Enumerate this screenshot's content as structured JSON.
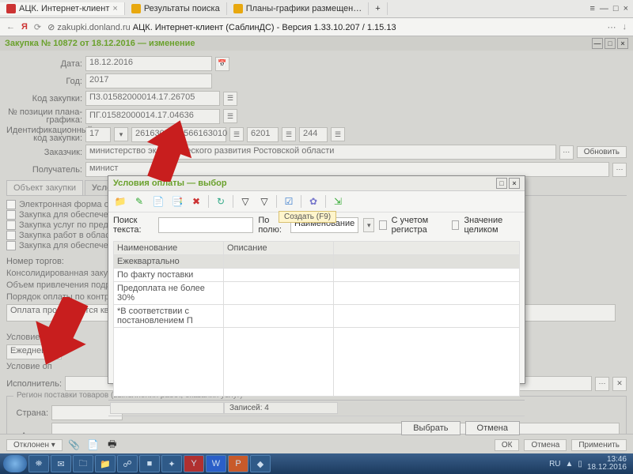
{
  "browser": {
    "tabs": [
      {
        "label": "АЦК. Интернет-клиент"
      },
      {
        "label": "Результаты поиска"
      },
      {
        "label": "Планы-графики размещен…"
      }
    ],
    "url_prefix": "zakupki.donland.ru",
    "url_rest": "  АЦК. Интернет-клиент (СаблинДС) - Версия 1.33.10.207 / 1.15.13"
  },
  "page_title": "Закупка № 10872 от 18.12.2016 — изменение",
  "form": {
    "date_lbl": "Дата:",
    "date": "18.12.2016",
    "year_lbl": "Год:",
    "year": "2017",
    "code_lbl": "Код закупки:",
    "code": "П3.01582000014.17.26705",
    "pos_lbl": "№ позиции плана-графика:",
    "pos": "ПГ.01582000014.17.04636",
    "id_lbl": "Идентификационный код закупки:",
    "id_a": "17",
    "id_b": "2616305358566163010",
    "id_c": "6201",
    "id_d": "244",
    "cust_lbl": "Заказчик:",
    "cust": "министерство экономического развития Ростовской области",
    "recv_lbl": "Получатель:",
    "recv": "минист",
    "refresh": "Обновить"
  },
  "subtabs": [
    "Объект закупки",
    "Условия закуп"
  ],
  "checks": [
    "Электронная форма определени…",
    "Закупка для обеспечения оборо…",
    "Закупка услуг по предоставлен…",
    "Закупка работ в области исполь…",
    "Закупка для обеспечения норм…"
  ],
  "left_labels": {
    "nomer": "Номер торгов:",
    "konsol": "Консолидированная закупка:",
    "obem": "Объем привлечения подрядчикс",
    "poryadok": "Порядок оплаты по контракту:",
    "poryadok_val": "Оплата производится квартально в",
    "usl_post": "Условие постав",
    "usl_post_val": "Ежедневн",
    "usl_opl": "Условие оп",
    "isp": "Исполнитель:",
    "grp": "Регион поставки товаров (выполнения работ, оказания услуг)",
    "country": "Страна:",
    "addr": "Адрес:"
  },
  "modal": {
    "title": "Условия оплаты — выбор",
    "search_lbl": "Поиск текста:",
    "field_lbl": "По полю:",
    "field_val": "Наименование",
    "reg": "С учетом регистра",
    "whole": "Значение целиком",
    "cols": [
      "Наименование",
      "Описание"
    ],
    "rows": [
      "Ежеквартально",
      "По факту поставки",
      "Предоплата не более 30%",
      "*В соответствии с постановлением П"
    ],
    "records": "Записей: 4",
    "select": "Выбрать",
    "cancel": "Отмена",
    "tooltip": "Создать (F9)"
  },
  "footer": {
    "otkl": "Отклонен",
    "ok": "ОК",
    "cancel": "Отмена",
    "apply": "Применить"
  },
  "tray": {
    "lang": "RU",
    "time": "13:46",
    "date": "18.12.2016"
  }
}
